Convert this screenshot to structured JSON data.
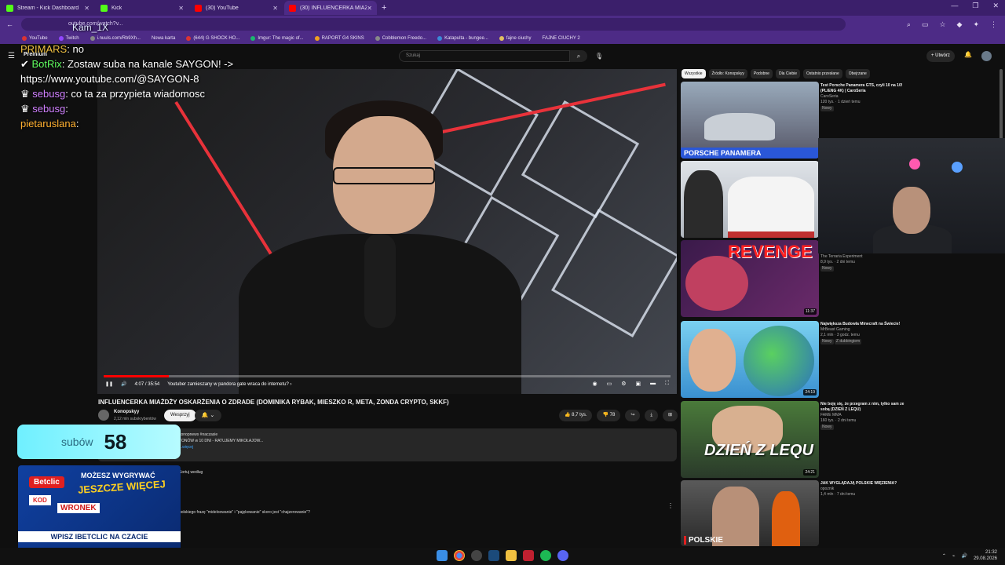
{
  "browser": {
    "tabs": [
      {
        "label": "Stream - Kick Dashboard",
        "color": "#53fc18",
        "active": false
      },
      {
        "label": "Kick",
        "color": "#53fc18",
        "active": false
      },
      {
        "label": "(30) YouTube",
        "color": "#ff0000",
        "active": false
      },
      {
        "label": "(30) INFLUENCERKA MIAŻDŻ",
        "color": "#ff0000",
        "active": true
      }
    ],
    "url": "outube.com/watch?v...",
    "bookmarks": [
      "YouTube",
      "Twitch",
      "i.nuuls.com/Rb9Xh...",
      "Nowa karta",
      "(644) G SHOCK HO...",
      "Imgur: The magic of...",
      "RAPORT G4 SKINS",
      "Cobblemon Freedo...",
      "Katapulta - bungee...",
      "fajne ciuchy",
      "FAJNE CIUCHY 2"
    ]
  },
  "youtube": {
    "logo": "Premium",
    "search_placeholder": "Szukaj",
    "create_label": "Utwórz",
    "notif_count": "9+"
  },
  "player": {
    "time": "4:07 / 35:54",
    "chapter": "Youtuber zamieszany w pandora gate wraca do internetu? ›",
    "progress": 0.115
  },
  "video": {
    "title": "INFLUENCERKA MIAŻDŻY OSKARŻENIA O ZDRADE (DOMINIKA RYBAK, MIESZKO R, META, ZONDA CRYPTO, SKKF)",
    "channel": "Konopskyy",
    "subscribers": "2,12 mln subskrybentów",
    "join_label": "Wesprzyj",
    "likes": "8,7 tys.",
    "dislikes": "78",
    "desc_line1": "konopnews #naczasie",
    "desc_line2": "TONÓW w 10 DNI - RATUJEMY MIKOŁAJOW...",
    "desc_more": "...więcej",
    "sort_label": "Sortuj według",
    "comment_text": "polskiego frazę \"mideloowanie\" i \"pajękowanie\" skoro jest \"chajzerowanie\"?"
  },
  "sidebar": {
    "chips": [
      "Wszystkie",
      "Źródło: Konopskyy",
      "Podobne",
      "Dla Ciebie",
      "Ostatnio przesłane",
      "Obejrzane"
    ],
    "recommendations": [
      {
        "title": "Test Porsche Panamera GTS, czyli 10 na 10! (PL/ENG 4K) | CaroSeria",
        "channel": "CaroSeria",
        "meta": "120 tys. · 1 dzień temu",
        "badge": "Nowy",
        "thumb_text": "PORSCHE PANAMERA",
        "duration": ""
      },
      {
        "title": "",
        "channel": "",
        "meta": "",
        "badge": "",
        "thumb_text": "",
        "duration": ""
      },
      {
        "title": "",
        "channel": "The Terraria Experiment",
        "meta": "8,9 tys. · 2 dni temu",
        "badge": "Nowy",
        "thumb_text": "REVENGE",
        "duration": "11:37"
      },
      {
        "title": "Największa Budowla Minecraft na Świecie!",
        "channel": "MrBeast Gaming",
        "meta": "2,1 mln · 3 godz. temu",
        "badge": "Nowy",
        "thumb_text": "",
        "duration": "24:19"
      },
      {
        "title": "Nie boję się, że przegram z nim, tylko sam ze sobą (DZIEŃ Z LEQU)",
        "channel": "FAME MMA",
        "meta": "160 tys. · 2 dni temu",
        "badge": "Nowy",
        "thumb_text": "DZIEŃ Z LEQU",
        "duration": "24:21"
      },
      {
        "title": "JAK WYGLĄDAJĄ POLSKIE WIĘZIENIA?",
        "channel": "opoznik",
        "meta": "1,4 mln · 7 dni temu",
        "badge": "",
        "thumb_text": "POLSKIE",
        "duration": ""
      }
    ],
    "dubbing": "Z dubbingiem"
  },
  "overlay": {
    "chat": [
      {
        "user": "PRIMARS",
        "msg": ": no"
      },
      {
        "user": "BotRix",
        "msg": ": Zostaw suba na kanale SAYGON! -> https://www.youtube.com/@SAYGON-8"
      },
      {
        "user": "sebusg",
        "msg": ": co ta za przypieta wiadomosc"
      },
      {
        "user": "sebusg",
        "msg": ":"
      },
      {
        "user": "pietaruslana",
        "msg": ":"
      }
    ],
    "streamer": "Kam_1X",
    "sub_label": "subów",
    "sub_count": "58",
    "ad": {
      "brand": "Betclic",
      "headline1": "MOŻESZ WYGRYWAĆ",
      "headline2": "JESZCZE WIĘCEJ",
      "kod": "KOD",
      "code": "WRONEK",
      "bottom": "WPISZ IBETCLIC NA CZACIE"
    }
  },
  "taskbar": {
    "time": "21:32",
    "date": "29.08.2026"
  }
}
